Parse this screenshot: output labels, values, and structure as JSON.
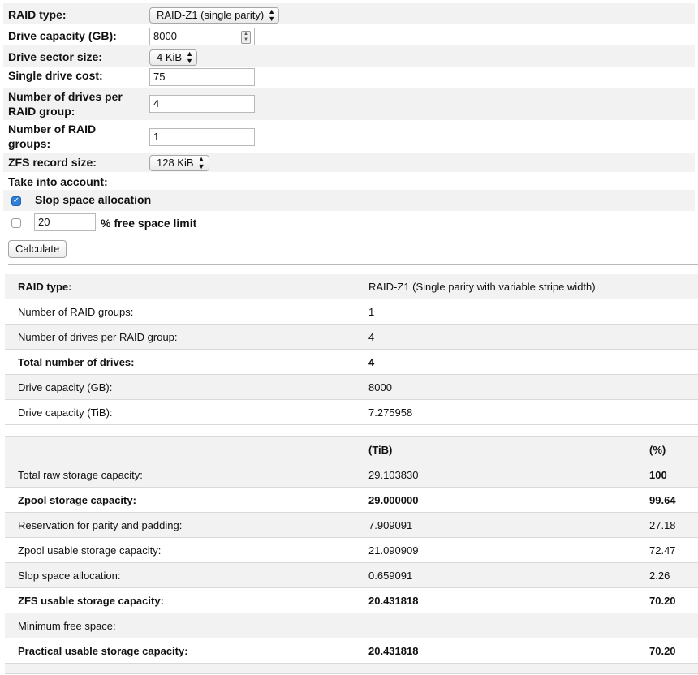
{
  "form": {
    "raid_type": {
      "label": "RAID type:",
      "value": "RAID-Z1 (single parity)"
    },
    "drive_capacity": {
      "label": "Drive capacity (GB):",
      "value": "8000"
    },
    "sector_size": {
      "label": "Drive sector size:",
      "value": "4 KiB"
    },
    "drive_cost": {
      "label": "Single drive cost:",
      "value": "75"
    },
    "drives_per_group": {
      "label": "Number of drives per RAID group:",
      "value": "4"
    },
    "raid_groups": {
      "label": "Number of RAID groups:",
      "value": "1"
    },
    "record_size": {
      "label": "ZFS record size:",
      "value": "128 KiB"
    },
    "take_into_account": "Take into account:",
    "slop": {
      "label": "Slop space allocation",
      "checked": true
    },
    "free_space": {
      "label": "% free space limit",
      "value": "20",
      "checked": false
    },
    "calculate_label": "Calculate"
  },
  "results": {
    "info_rows": [
      {
        "label": "RAID type:",
        "value": "RAID-Z1 (Single parity with variable stripe width)",
        "bold": true,
        "shade": true
      },
      {
        "label": "Number of RAID groups:",
        "value": "1",
        "bold": false,
        "shade": false
      },
      {
        "label": "Number of drives per RAID group:",
        "value": "4",
        "bold": false,
        "shade": true
      },
      {
        "label": "Total number of drives:",
        "value": "4",
        "bold": true,
        "shade": false
      },
      {
        "label": "Drive capacity (GB):",
        "value": "8000",
        "bold": false,
        "shade": true
      },
      {
        "label": "Drive capacity (TiB):",
        "value": "7.275958",
        "bold": false,
        "shade": false
      }
    ],
    "header": {
      "tib": "(TiB)",
      "pct": "(%)"
    },
    "capacity_rows": [
      {
        "label": "Total raw storage capacity:",
        "tib": "29.103830",
        "pct": "100",
        "bold": false,
        "pct_bold": true,
        "shade": true
      },
      {
        "label": "Zpool storage capacity:",
        "tib": "29.000000",
        "pct": "99.64",
        "bold": true,
        "pct_bold": true,
        "shade": false
      },
      {
        "label": "Reservation for parity and padding:",
        "tib": "7.909091",
        "pct": "27.18",
        "bold": false,
        "pct_bold": false,
        "shade": true
      },
      {
        "label": "Zpool usable storage capacity:",
        "tib": "21.090909",
        "pct": "72.47",
        "bold": false,
        "pct_bold": false,
        "shade": false
      },
      {
        "label": "Slop space allocation:",
        "tib": "0.659091",
        "pct": "2.26",
        "bold": false,
        "pct_bold": false,
        "shade": true
      },
      {
        "label": "ZFS usable storage capacity:",
        "tib": "20.431818",
        "pct": "70.20",
        "bold": true,
        "pct_bold": true,
        "shade": false
      },
      {
        "label": "Minimum free space:",
        "tib": "",
        "pct": "",
        "bold": false,
        "pct_bold": false,
        "shade": true
      },
      {
        "label": "Practical usable storage capacity:",
        "tib": "20.431818",
        "pct": "70.20",
        "bold": true,
        "pct_bold": true,
        "shade": false
      }
    ]
  }
}
